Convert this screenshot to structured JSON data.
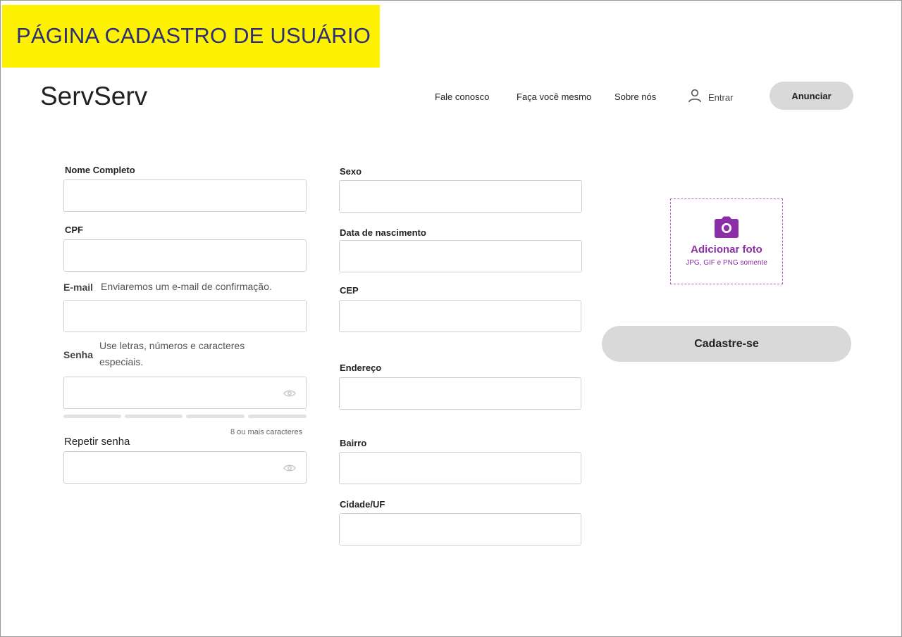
{
  "banner": {
    "title": "PÁGINA CADASTRO DE USUÁRIO"
  },
  "header": {
    "logo": "ServServ",
    "nav": [
      "Fale conosco",
      "Faça você mesmo",
      "Sobre nós"
    ],
    "login_label": "Entrar",
    "advertise_label": "Anunciar"
  },
  "form": {
    "left": {
      "name_label": "Nome Completo",
      "cpf_label": "CPF",
      "email_label": "E-mail",
      "email_hint": "Enviaremos um e-mail de confirmação.",
      "password_label": "Senha",
      "password_hint": "Use letras, números e caracteres especiais.",
      "password_min_hint": "8 ou mais caracteres",
      "repeat_password_label": "Repetir senha"
    },
    "middle": {
      "sex_label": "Sexo",
      "birth_label": "Data de nascimento",
      "cep_label": "CEP",
      "address_label": "Endereço",
      "district_label": "Bairro",
      "city_label": "Cidade/UF"
    },
    "photo": {
      "title": "Adicionar foto",
      "subtitle": "JPG, GIF e PNG somente"
    },
    "submit_label": "Cadastre-se"
  },
  "icons": {
    "user": "user-icon",
    "eye": "eye-icon",
    "camera": "camera-icon"
  },
  "colors": {
    "banner_bg": "#fff200",
    "banner_text": "#2b2f7a",
    "accent_purple": "#8c2fa6",
    "button_gray": "#d9d9d9"
  }
}
